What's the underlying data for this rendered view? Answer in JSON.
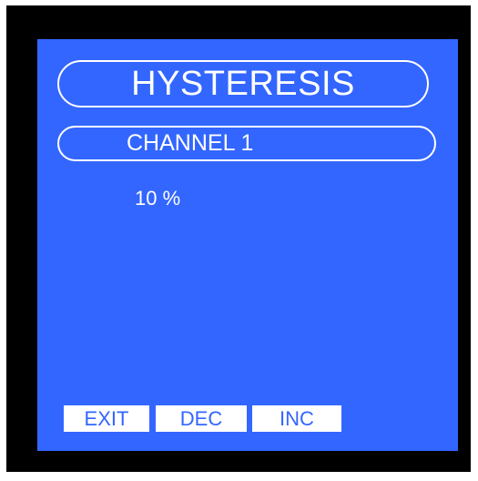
{
  "screen": {
    "title": "HYSTERESIS",
    "channel": "CHANNEL 1",
    "value": "10 %"
  },
  "softkeys": {
    "exit": "EXIT",
    "dec": "DEC",
    "inc": "INC"
  },
  "colors": {
    "bezel": "#000000",
    "screen": "#3366ff",
    "text": "#ffffff",
    "key_background": "#ffffff",
    "key_text": "#3366ff"
  }
}
